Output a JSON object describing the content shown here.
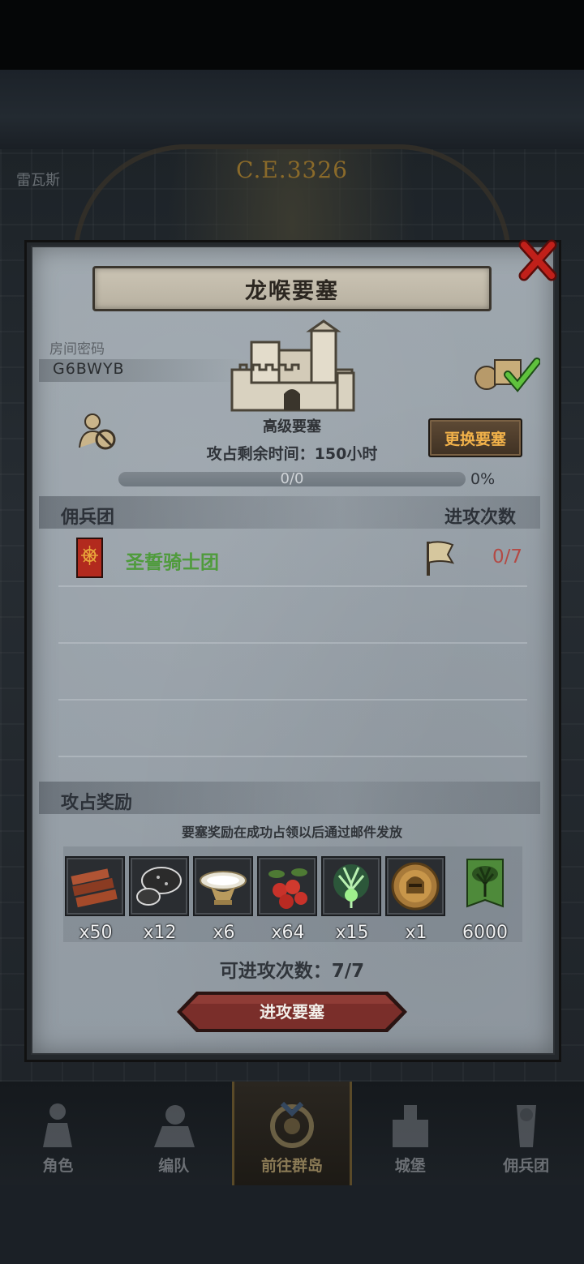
{
  "backdrop": {
    "era": "C.E.3326",
    "map_town": "雷瓦斯"
  },
  "modal": {
    "title": "龙喉要塞",
    "room_code_label": "房间密码",
    "room_code": "G6BWYB",
    "fortress_type": "高级要塞",
    "change_button": "更换要塞",
    "time_remaining": "攻占剩余时间：150小时",
    "progress": {
      "text": "0/0",
      "percent_label": "0%",
      "value": 0
    },
    "mercenary_section": {
      "header_left": "佣兵团",
      "header_right": "进攻次数",
      "rows": [
        {
          "name": "圣誓骑士团",
          "attacks": "0/7",
          "banner_color": "#b22a1e"
        }
      ]
    },
    "reward_section": {
      "header": "攻占奖励",
      "note": "要塞奖励在成功占领以后通过邮件发放",
      "items": [
        {
          "icon": "wood-planks-icon",
          "qty": "x50"
        },
        {
          "icon": "stone-ore-icon",
          "qty": "x12"
        },
        {
          "icon": "white-bowl-icon",
          "qty": "x6"
        },
        {
          "icon": "red-berries-icon",
          "qty": "x64"
        },
        {
          "icon": "green-spirit-tree-icon",
          "qty": "x15"
        },
        {
          "icon": "knight-helmet-medal-icon",
          "qty": "x1"
        },
        {
          "icon": "tree-banner-icon",
          "qty": "6000"
        }
      ]
    },
    "attack_times": "可进攻次数：7/7",
    "attack_button": "进攻要塞"
  },
  "nav": {
    "items": [
      {
        "label": "角色",
        "icon": "knight-icon",
        "active": false
      },
      {
        "label": "编队",
        "icon": "formation-icon",
        "active": false
      },
      {
        "label": "前往群岛",
        "icon": "compass-icon",
        "active": true
      },
      {
        "label": "城堡",
        "icon": "castle-icon",
        "active": false
      },
      {
        "label": "佣兵团",
        "icon": "mercenary-icon",
        "active": false
      }
    ]
  },
  "colors": {
    "accent_gold": "#f2b24a",
    "merc_green": "#4f9b3c",
    "attack_count_red": "#b34a45",
    "close_red": "#c0201a",
    "attack_button": "#7a2e2a"
  }
}
